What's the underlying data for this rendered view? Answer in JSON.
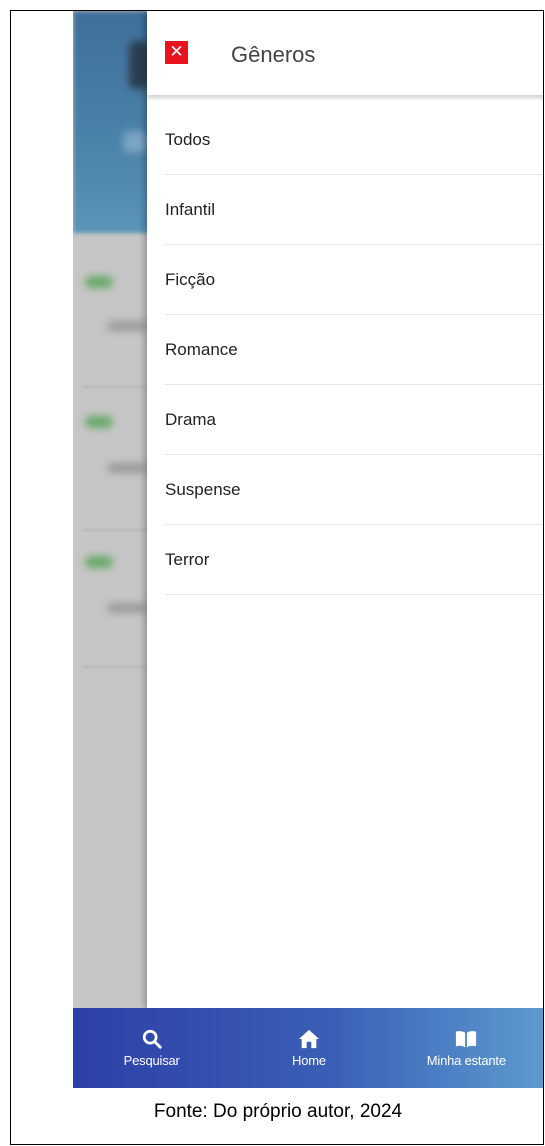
{
  "drawer": {
    "close_icon": "close-icon",
    "title": "Gêneros",
    "genres": [
      "Todos",
      "Infantil",
      "Ficção",
      "Romance",
      "Drama",
      "Suspense",
      "Terror"
    ]
  },
  "bottom_nav": {
    "items": [
      {
        "label": "Pesquisar",
        "icon": "search-icon"
      },
      {
        "label": "Home",
        "icon": "home-icon"
      },
      {
        "label": "Minha estante",
        "icon": "book-icon"
      }
    ]
  },
  "caption": "Fonte: Do próprio autor, 2024",
  "colors": {
    "close_button": "#e8131c",
    "nav_gradient_start": "#2d3fa8",
    "nav_gradient_end": "#5e9bd0",
    "header_blue": "#4c83a9"
  }
}
